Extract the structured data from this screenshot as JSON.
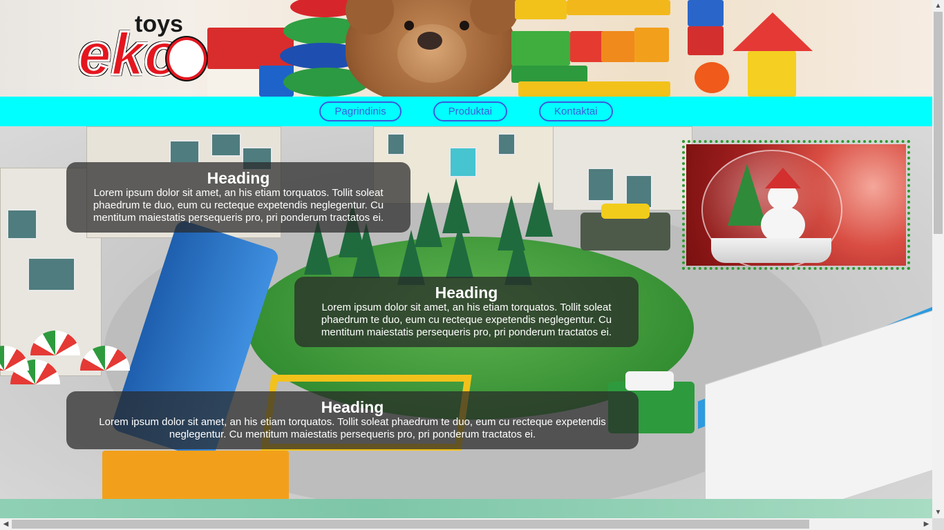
{
  "logo": {
    "top_text": "toys",
    "main_text": "eko"
  },
  "nav": {
    "items": [
      {
        "label": "Pagrindinis"
      },
      {
        "label": "Produktai"
      },
      {
        "label": "Kontaktai"
      }
    ]
  },
  "panels": [
    {
      "heading": "Heading",
      "text": "Lorem ipsum dolor sit amet, an his etiam torquatos. Tollit soleat phaedrum te duo, eum cu recteque expetendis neglegentur. Cu mentitum maiestatis persequeris pro, pri ponderum tractatos ei."
    },
    {
      "heading": "Heading",
      "text": "Lorem ipsum dolor sit amet, an his etiam torquatos. Tollit soleat phaedrum te duo, eum cu recteque expetendis neglegentur. Cu mentitum maiestatis persequeris pro, pri ponderum tractatos ei."
    },
    {
      "heading": "Heading",
      "text": "Lorem ipsum dolor sit amet, an his etiam torquatos. Tollit soleat phaedrum te duo, eum cu recteque expetendis neglegentur. Cu mentitum maiestatis persequeris pro, pri ponderum tractatos ei."
    }
  ],
  "colors": {
    "nav_background": "#00ffff",
    "nav_button": "#3b5bdb",
    "logo_red": "#e4161f",
    "frame_border": "#2f9a2f"
  },
  "icons": {
    "scroll_up": "▲",
    "scroll_down": "▼",
    "scroll_left": "◀",
    "scroll_right": "▶"
  }
}
